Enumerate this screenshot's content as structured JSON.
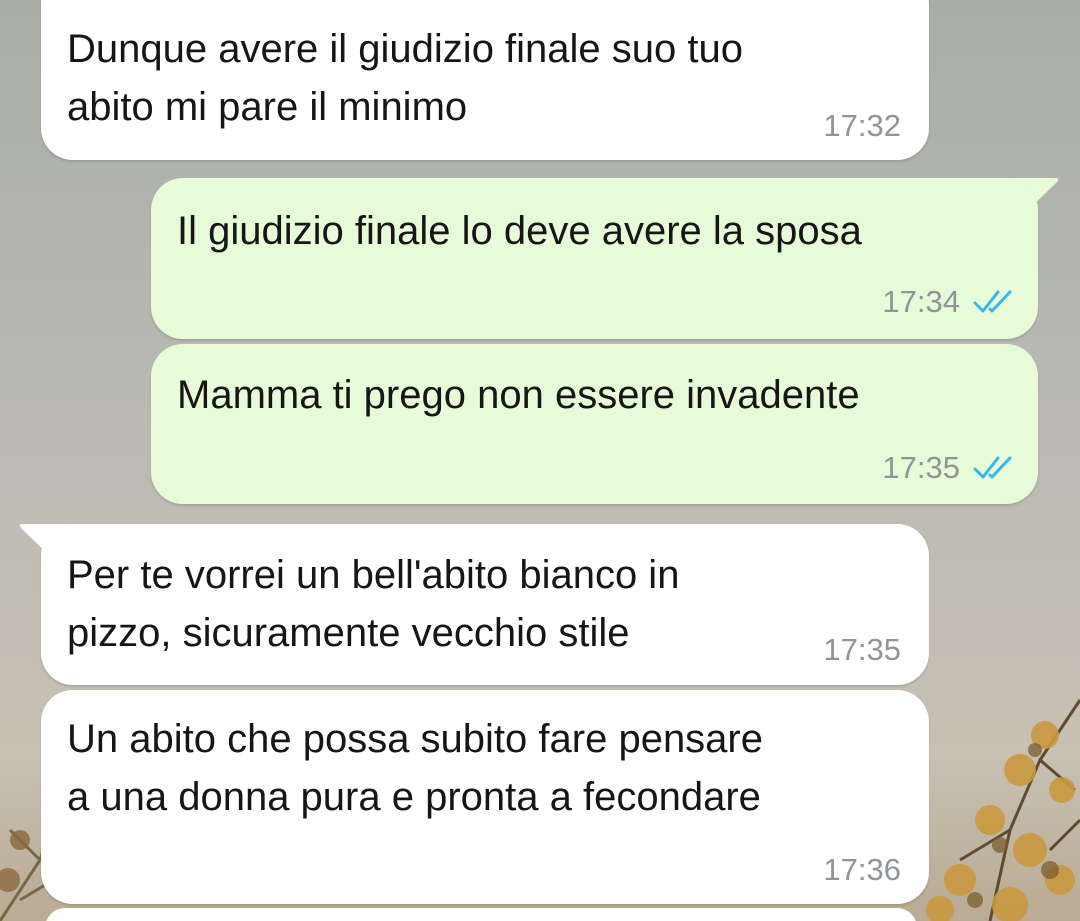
{
  "colors": {
    "incoming_bubble": "#ffffff",
    "outgoing_bubble": "#e7fbd8",
    "message_text": "#161616",
    "timestamp": "#8f9598",
    "read_ticks": "#34b7f1"
  },
  "messages": [
    {
      "direction": "incoming",
      "lines": [
        "Dunque avere il giudizio finale suo tuo",
        "abito mi pare il minimo"
      ],
      "time": "17:32"
    },
    {
      "direction": "outgoing",
      "lines": [
        "Il giudizio finale lo deve avere la sposa"
      ],
      "time": "17:34",
      "status_icon": "double-check-read-icon"
    },
    {
      "direction": "outgoing",
      "lines": [
        "Mamma ti prego non essere invadente"
      ],
      "time": "17:35",
      "status_icon": "double-check-read-icon"
    },
    {
      "direction": "incoming",
      "lines": [
        "Per te vorrei un bell'abito bianco in",
        "pizzo, sicuramente vecchio stile"
      ],
      "time": "17:35"
    },
    {
      "direction": "incoming",
      "lines": [
        "Un abito che possa subito fare pensare",
        "a una donna pura e pronta a fecondare"
      ],
      "time": "17:36"
    }
  ]
}
